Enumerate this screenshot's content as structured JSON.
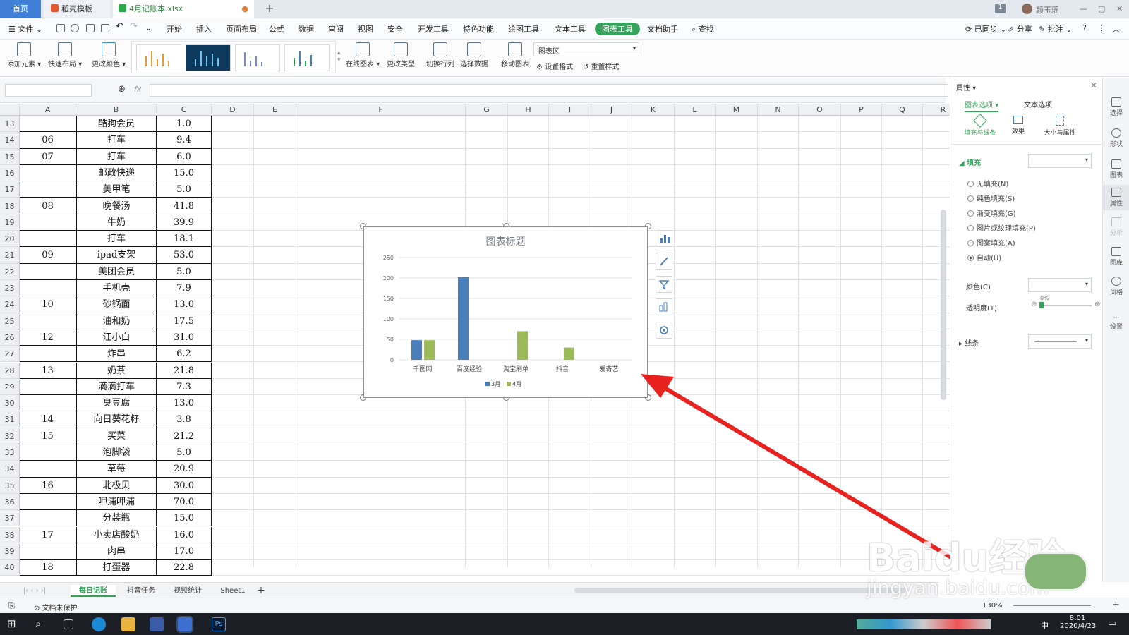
{
  "tabs": {
    "home": "首页",
    "template": "稻壳模板",
    "file": "4月记账本.xlsx",
    "add": "+"
  },
  "user": {
    "badge": "1",
    "name": "颜玉瑶"
  },
  "menus": [
    "文件",
    "开始",
    "插入",
    "页面布局",
    "公式",
    "数据",
    "审阅",
    "视图",
    "安全",
    "开发工具",
    "特色功能",
    "绘图工具",
    "文本工具",
    "图表工具",
    "文档助手"
  ],
  "menu_active": "图表工具",
  "search_label": "查找",
  "top_right": {
    "sync": "已同步",
    "share": "分享",
    "comment": "批注",
    "help": "?"
  },
  "ribbon": {
    "add_element": "添加元素",
    "quick_layout": "快速布局",
    "change_color": "更改颜色",
    "online_chart": "在线图表",
    "change_type": "更改类型",
    "switch_rowcol": "切换行列",
    "select_data": "选择数据",
    "move_chart": "移动图表",
    "area_select": "图表区",
    "set_format": "设置格式",
    "reset_style": "重置样式"
  },
  "formula": {
    "fx": "fx",
    "namebox": "",
    "value": ""
  },
  "columns": [
    "A",
    "B",
    "C",
    "D",
    "E",
    "F",
    "G",
    "H",
    "I",
    "J",
    "K",
    "L",
    "M",
    "N",
    "O",
    "P",
    "Q",
    "R"
  ],
  "rows": [
    {
      "n": "13",
      "a": "",
      "b": "酷狗会员",
      "c": "1.0"
    },
    {
      "n": "14",
      "a": "06",
      "b": "打车",
      "c": "9.4"
    },
    {
      "n": "15",
      "a": "07",
      "b": "打车",
      "c": "6.0"
    },
    {
      "n": "16",
      "a": "",
      "b": "邮政快递",
      "c": "15.0"
    },
    {
      "n": "17",
      "a": "",
      "b": "美甲笔",
      "c": "5.0"
    },
    {
      "n": "18",
      "a": "08",
      "b": "晚餐汤",
      "c": "41.8"
    },
    {
      "n": "19",
      "a": "",
      "b": "牛奶",
      "c": "39.9"
    },
    {
      "n": "20",
      "a": "",
      "b": "打车",
      "c": "18.1"
    },
    {
      "n": "21",
      "a": "09",
      "b": "ipad支架",
      "c": "53.0"
    },
    {
      "n": "22",
      "a": "",
      "b": "美团会员",
      "c": "5.0"
    },
    {
      "n": "23",
      "a": "",
      "b": "手机壳",
      "c": "7.9"
    },
    {
      "n": "24",
      "a": "10",
      "b": "砂锅面",
      "c": "13.0"
    },
    {
      "n": "25",
      "a": "",
      "b": "油和奶",
      "c": "17.5"
    },
    {
      "n": "26",
      "a": "12",
      "b": "江小白",
      "c": "31.0"
    },
    {
      "n": "27",
      "a": "",
      "b": "炸串",
      "c": "6.2"
    },
    {
      "n": "28",
      "a": "13",
      "b": "奶茶",
      "c": "21.8"
    },
    {
      "n": "29",
      "a": "",
      "b": "滴滴打车",
      "c": "7.3"
    },
    {
      "n": "30",
      "a": "",
      "b": "臭豆腐",
      "c": "13.0"
    },
    {
      "n": "31",
      "a": "14",
      "b": "向日葵花籽",
      "c": "3.8"
    },
    {
      "n": "32",
      "a": "15",
      "b": "买菜",
      "c": "21.2"
    },
    {
      "n": "33",
      "a": "",
      "b": "泡脚袋",
      "c": "5.0"
    },
    {
      "n": "34",
      "a": "",
      "b": "草莓",
      "c": "20.9"
    },
    {
      "n": "35",
      "a": "16",
      "b": "北极贝",
      "c": "30.0"
    },
    {
      "n": "36",
      "a": "",
      "b": "呷浦呷浦",
      "c": "70.0"
    },
    {
      "n": "37",
      "a": "",
      "b": "分装瓶",
      "c": "15.0"
    },
    {
      "n": "38",
      "a": "17",
      "b": "小卖店酸奶",
      "c": "16.0"
    },
    {
      "n": "39",
      "a": "",
      "b": "肉串",
      "c": "17.0"
    },
    {
      "n": "40",
      "a": "18",
      "b": "打蛋器",
      "c": "22.8"
    }
  ],
  "chart_data": {
    "type": "bar",
    "title": "图表标题",
    "categories": [
      "千图网",
      "百度经验",
      "淘宝刷单",
      "抖音",
      "爱奇艺"
    ],
    "series": [
      {
        "name": "3月",
        "values": [
          48,
          202,
          0,
          0,
          0
        ],
        "color": "#4a7ebb"
      },
      {
        "name": "4月",
        "values": [
          48,
          0,
          70,
          30,
          0
        ],
        "color": "#9bbb59"
      }
    ],
    "ylim": [
      0,
      250
    ],
    "yticks": [
      "0",
      "50",
      "100",
      "150",
      "200",
      "250"
    ],
    "grid": true,
    "legend": "bottom"
  },
  "panel": {
    "title": "属性",
    "tab_chart": "图表选项",
    "tab_text": "文本选项",
    "sub_fill_line": "填充与线条",
    "sub_effect": "效果",
    "sub_size": "大小与属性",
    "fill_section": "填充",
    "options": [
      "无填充(N)",
      "纯色填充(S)",
      "渐变填充(G)",
      "图片或纹理填充(P)",
      "图案填充(A)",
      "自动(U)"
    ],
    "selected_option": "自动(U)",
    "color_label": "颜色(C)",
    "transparency_label": "透明度(T)",
    "transparency_value": "0%",
    "line_section": "线条"
  },
  "right_bar": [
    "选择",
    "形状",
    "图表",
    "属性",
    "分析",
    "图库",
    "风格",
    "设置"
  ],
  "sheets": [
    "每日记账",
    "抖音任务",
    "视频统计",
    "Sheet1"
  ],
  "active_sheet": "每日记账",
  "status": {
    "protect": "文档未保护",
    "zoom": "130%"
  },
  "taskbar": {
    "time": "8:01",
    "date": "2020/4/23",
    "ime": "中"
  },
  "watermark": {
    "text": "Baidu经验",
    "url": "jingyan.baidu.com"
  },
  "colors": {
    "accent": "#35a35a",
    "series1": "#4a7ebb",
    "series2": "#9bbb59",
    "arrow": "#e8231f"
  }
}
